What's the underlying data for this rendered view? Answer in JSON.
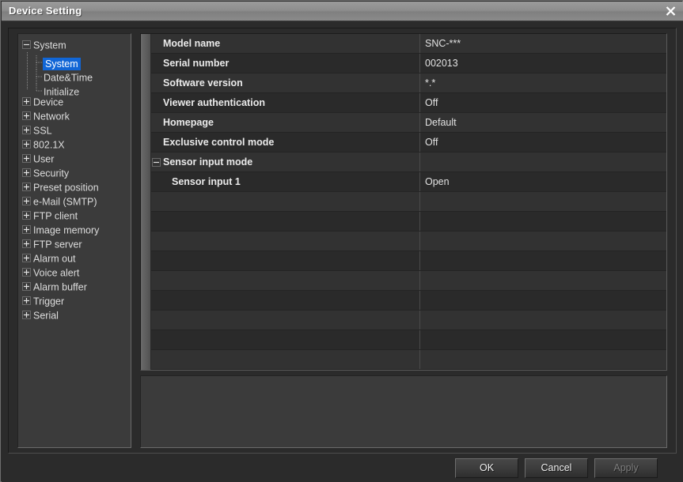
{
  "window": {
    "title": "Device Setting",
    "close_icon": "close-x-icon"
  },
  "tree": {
    "items": [
      {
        "label": "System",
        "toggle": "minus",
        "level": 0,
        "selected": false
      },
      {
        "label": "System",
        "toggle": "none",
        "level": 1,
        "selected": true
      },
      {
        "label": "Date&Time",
        "toggle": "none",
        "level": 1,
        "selected": false
      },
      {
        "label": "Initialize",
        "toggle": "none",
        "level": 1,
        "selected": false
      },
      {
        "label": "Device",
        "toggle": "plus",
        "level": 0,
        "selected": false
      },
      {
        "label": "Network",
        "toggle": "plus",
        "level": 0,
        "selected": false
      },
      {
        "label": "SSL",
        "toggle": "plus",
        "level": 0,
        "selected": false
      },
      {
        "label": "802.1X",
        "toggle": "plus",
        "level": 0,
        "selected": false
      },
      {
        "label": "User",
        "toggle": "plus",
        "level": 0,
        "selected": false
      },
      {
        "label": "Security",
        "toggle": "plus",
        "level": 0,
        "selected": false
      },
      {
        "label": "Preset position",
        "toggle": "plus",
        "level": 0,
        "selected": false
      },
      {
        "label": "e-Mail (SMTP)",
        "toggle": "plus",
        "level": 0,
        "selected": false
      },
      {
        "label": "FTP client",
        "toggle": "plus",
        "level": 0,
        "selected": false
      },
      {
        "label": "Image memory",
        "toggle": "plus",
        "level": 0,
        "selected": false
      },
      {
        "label": "FTP server",
        "toggle": "plus",
        "level": 0,
        "selected": false
      },
      {
        "label": "Alarm out",
        "toggle": "plus",
        "level": 0,
        "selected": false
      },
      {
        "label": "Voice alert",
        "toggle": "plus",
        "level": 0,
        "selected": false
      },
      {
        "label": "Alarm buffer",
        "toggle": "plus",
        "level": 0,
        "selected": false
      },
      {
        "label": "Trigger",
        "toggle": "plus",
        "level": 0,
        "selected": false
      },
      {
        "label": "Serial",
        "toggle": "plus",
        "level": 0,
        "selected": false
      }
    ]
  },
  "table": {
    "rows": [
      {
        "name": "Model name",
        "value": "SNC-***",
        "toggle": "none",
        "indent": false
      },
      {
        "name": "Serial number",
        "value": "002013",
        "toggle": "none",
        "indent": false
      },
      {
        "name": "Software version",
        "value": "*.*",
        "toggle": "none",
        "indent": false
      },
      {
        "name": "Viewer authentication",
        "value": "Off",
        "toggle": "none",
        "indent": false
      },
      {
        "name": "Homepage",
        "value": "Default",
        "toggle": "none",
        "indent": false
      },
      {
        "name": "Exclusive control mode",
        "value": "Off",
        "toggle": "none",
        "indent": false
      },
      {
        "name": "Sensor input mode",
        "value": "",
        "toggle": "minus",
        "indent": false
      },
      {
        "name": "Sensor input 1",
        "value": "Open",
        "toggle": "none",
        "indent": true
      },
      {
        "name": "",
        "value": "",
        "toggle": "none",
        "indent": false
      },
      {
        "name": "",
        "value": "",
        "toggle": "none",
        "indent": false
      },
      {
        "name": "",
        "value": "",
        "toggle": "none",
        "indent": false
      },
      {
        "name": "",
        "value": "",
        "toggle": "none",
        "indent": false
      },
      {
        "name": "",
        "value": "",
        "toggle": "none",
        "indent": false
      },
      {
        "name": "",
        "value": "",
        "toggle": "none",
        "indent": false
      },
      {
        "name": "",
        "value": "",
        "toggle": "none",
        "indent": false
      },
      {
        "name": "",
        "value": "",
        "toggle": "none",
        "indent": false
      },
      {
        "name": "",
        "value": "",
        "toggle": "none",
        "indent": false
      }
    ]
  },
  "description": {
    "text": ""
  },
  "buttons": {
    "ok": "OK",
    "cancel": "Cancel",
    "apply": "Apply"
  },
  "colors": {
    "titlebar": "#8e8e8e",
    "selection": "#1166d6",
    "panel": "#3b3b3b",
    "row_odd": "#323232",
    "row_even": "#2a2a2a",
    "text": "#eaeaea",
    "disabled_text": "#7d7d7d"
  }
}
